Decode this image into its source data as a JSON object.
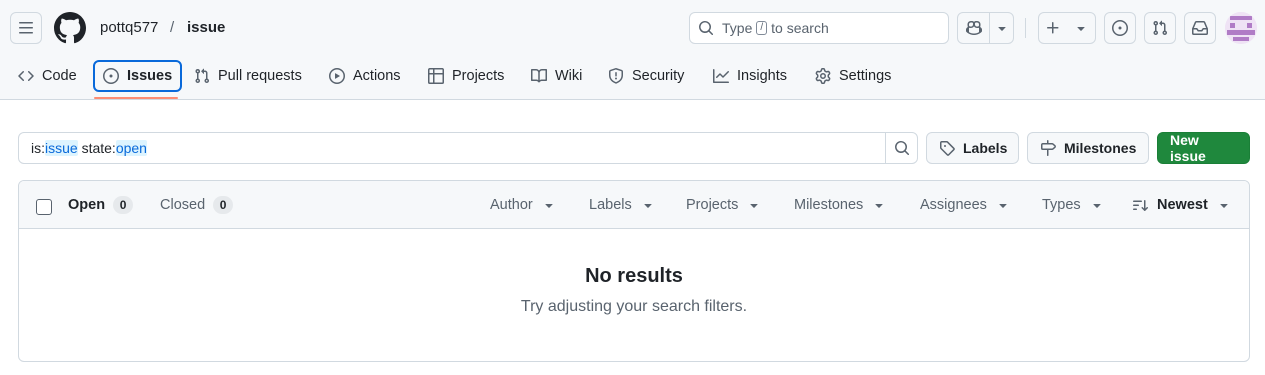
{
  "breadcrumb": {
    "owner": "pottq577",
    "separator": "/",
    "repo": "issue"
  },
  "search": {
    "prefix": "Type",
    "key": "/",
    "suffix": "to search"
  },
  "nav": [
    {
      "label": "Code",
      "icon": "code-icon"
    },
    {
      "label": "Issues",
      "icon": "issue-opened-icon",
      "active": true
    },
    {
      "label": "Pull requests",
      "icon": "git-pull-request-icon"
    },
    {
      "label": "Actions",
      "icon": "play-icon"
    },
    {
      "label": "Projects",
      "icon": "table-icon"
    },
    {
      "label": "Wiki",
      "icon": "book-icon"
    },
    {
      "label": "Security",
      "icon": "shield-icon"
    },
    {
      "label": "Insights",
      "icon": "graph-icon"
    },
    {
      "label": "Settings",
      "icon": "gear-icon"
    }
  ],
  "filter": {
    "q1_key": "is:",
    "q1_val": "issue",
    "q2_key": "state:",
    "q2_val": "open"
  },
  "buttons": {
    "labels": "Labels",
    "milestones": "Milestones",
    "new_issue": "New issue"
  },
  "list": {
    "open_label": "Open",
    "open_count": "0",
    "closed_label": "Closed",
    "closed_count": "0",
    "filters": [
      "Author",
      "Labels",
      "Projects",
      "Milestones",
      "Assignees",
      "Types"
    ],
    "sort_label": "Newest",
    "empty_title": "No results",
    "empty_subtitle": "Try adjusting your search filters."
  },
  "colors": {
    "accent": "#0969da",
    "primary_button": "#1f883d",
    "nav_underline": "#fd8c73"
  }
}
